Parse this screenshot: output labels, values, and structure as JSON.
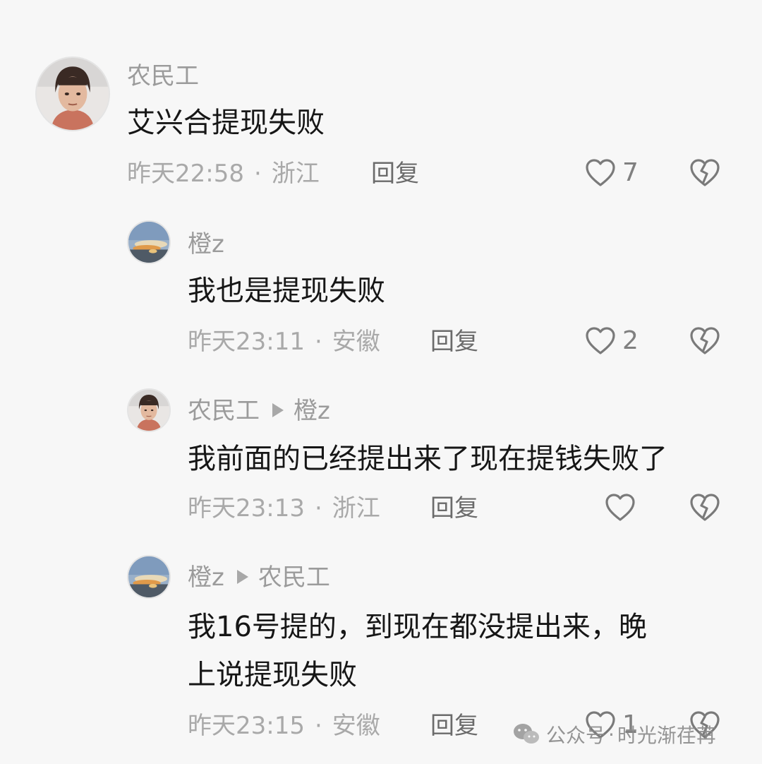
{
  "comments": [
    {
      "author": "农民工",
      "text": "艾兴合提现失败",
      "time": "昨天22:58",
      "location": "浙江",
      "reply_label": "回复",
      "likes": "7"
    },
    {
      "author": "橙z",
      "text": "我也是提现失败",
      "time": "昨天23:11",
      "location": "安徽",
      "reply_label": "回复",
      "likes": "2"
    },
    {
      "author": "农民工",
      "reply_to": "橙z",
      "text": "我前面的已经提出来了现在提钱失败了",
      "time": "昨天23:13",
      "location": "浙江",
      "reply_label": "回复",
      "likes": ""
    },
    {
      "author": "橙z",
      "reply_to": "农民工",
      "text_lines": [
        "我16号提的，到现在都没提出来，晚",
        "上说提现失败"
      ],
      "time": "昨天23:15",
      "location": "安徽",
      "reply_label": "回复",
      "likes": "1"
    }
  ],
  "meta_separator": "·",
  "watermark": {
    "prefix": "公众号",
    "separator": "·",
    "account": "时光渐荏苒"
  },
  "icons": {
    "like": "heart-outline-icon",
    "dislike": "broken-heart-icon",
    "watermark": "wechat-icon"
  },
  "colors": {
    "background": "#f7f7f7",
    "text": "#161616",
    "muted": "#a9a9a9",
    "icon": "#808080"
  }
}
